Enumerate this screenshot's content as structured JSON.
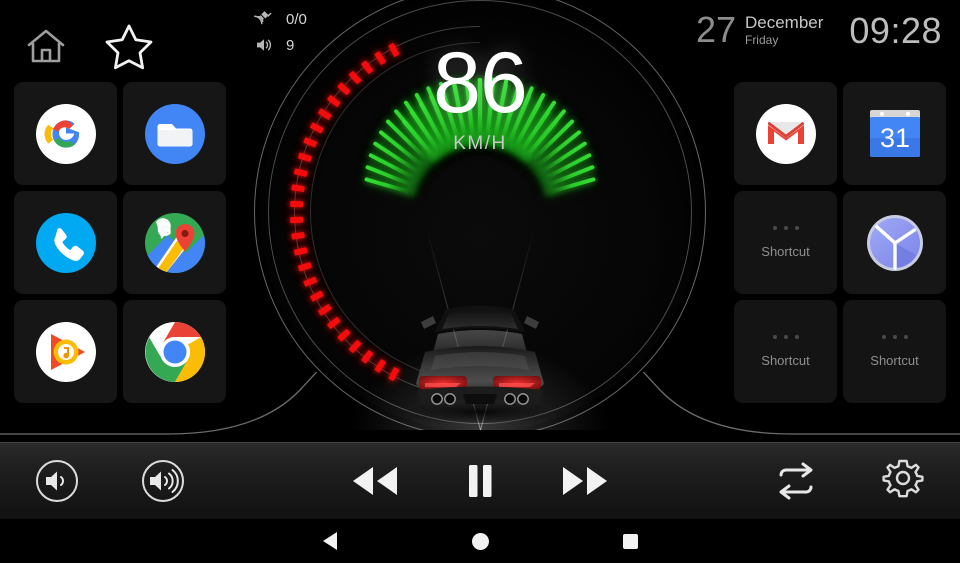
{
  "status": {
    "home_icon": "home-icon",
    "star_icon": "star-icon",
    "gps": {
      "icon": "satellite-icon",
      "value": "0/0"
    },
    "volume": {
      "icon": "speaker-icon",
      "value": "9"
    },
    "date": {
      "day": "27",
      "month": "December",
      "weekday": "Friday"
    },
    "time": "09:28"
  },
  "gauge": {
    "speed": "86",
    "unit": "KM/H",
    "green_tick_count": 21,
    "red_segment_count": 26,
    "colors": {
      "green": "#2ccc2c",
      "red": "#f40c0c",
      "ring": "#bebebe"
    }
  },
  "apps_left": [
    {
      "name": "google",
      "label": "Google"
    },
    {
      "name": "files",
      "label": "Files"
    },
    {
      "name": "phone",
      "label": "Phone"
    },
    {
      "name": "maps",
      "label": "Maps"
    },
    {
      "name": "play-music",
      "label": "Play Music"
    },
    {
      "name": "chrome",
      "label": "Chrome"
    }
  ],
  "apps_right": [
    {
      "name": "gmail",
      "label": "Gmail"
    },
    {
      "name": "calendar",
      "label": "Calendar",
      "day_number": "31"
    },
    {
      "name": "shortcut-1",
      "label": "Shortcut",
      "empty": true
    },
    {
      "name": "clock",
      "label": "Clock"
    },
    {
      "name": "shortcut-2",
      "label": "Shortcut",
      "empty": true
    },
    {
      "name": "shortcut-3",
      "label": "Shortcut",
      "empty": true
    }
  ],
  "shortcut_label": "Shortcut",
  "controls": [
    {
      "name": "volume-down-button",
      "icon": "volume-low-icon"
    },
    {
      "name": "volume-up-button",
      "icon": "volume-high-icon"
    },
    {
      "name": "rewind-button",
      "icon": "rewind-icon"
    },
    {
      "name": "pause-button",
      "icon": "pause-icon"
    },
    {
      "name": "fast-forward-button",
      "icon": "fast-forward-icon"
    },
    {
      "name": "repeat-button",
      "icon": "repeat-icon"
    },
    {
      "name": "settings-button",
      "icon": "gear-icon"
    }
  ],
  "navbar": [
    {
      "name": "nav-back-button",
      "icon": "back-triangle-icon"
    },
    {
      "name": "nav-home-button",
      "icon": "home-circle-icon"
    },
    {
      "name": "nav-recents-button",
      "icon": "recents-square-icon"
    }
  ]
}
